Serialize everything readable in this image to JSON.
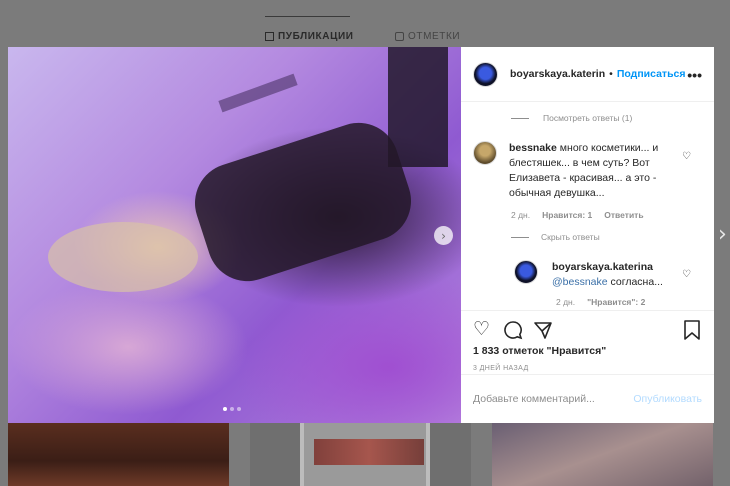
{
  "profile_tabs": {
    "posts": "ПУБЛИКАЦИИ",
    "tagged": "ОТМЕТКИ"
  },
  "post": {
    "username": "boyarskaya.katerin",
    "follow_label": "Подписаться",
    "separator": "•",
    "more": "•••",
    "next_glyph": "›",
    "likes_text": "1 833 отметок \"Нравится\"",
    "time_ago": "3 ДНЕЙ НАЗАД"
  },
  "comments": {
    "view_replies": "Посмотреть ответы (1)",
    "hide_replies": "Скрыть ответы",
    "comment": {
      "author": "bessnake",
      "text": "много косметики... и блестяшек... в чем суть? Вот Елизавета - красивая... а это - обычная девушка...",
      "time": "2 дн.",
      "likes": "Нравится: 1",
      "reply": "Ответить"
    },
    "reply": {
      "author": "boyarskaya.katerina",
      "mention": "@bessnake",
      "text": "согласна...",
      "time": "2 дн.",
      "likes": "\"Нравится\": 2"
    }
  },
  "add_comment": {
    "placeholder": "Добавьте комментарий...",
    "post_label": "Опубликовать"
  },
  "colors": {
    "accent": "#0095f6",
    "muted": "#8e8e8e",
    "post_disabled": "#b3dbff",
    "overlay": "#7b7b7b"
  },
  "icons": [
    "grid-icon",
    "tag-icon",
    "heart-icon",
    "comment-icon",
    "share-icon",
    "bookmark-icon",
    "more-icon",
    "chevron-right-icon"
  ]
}
